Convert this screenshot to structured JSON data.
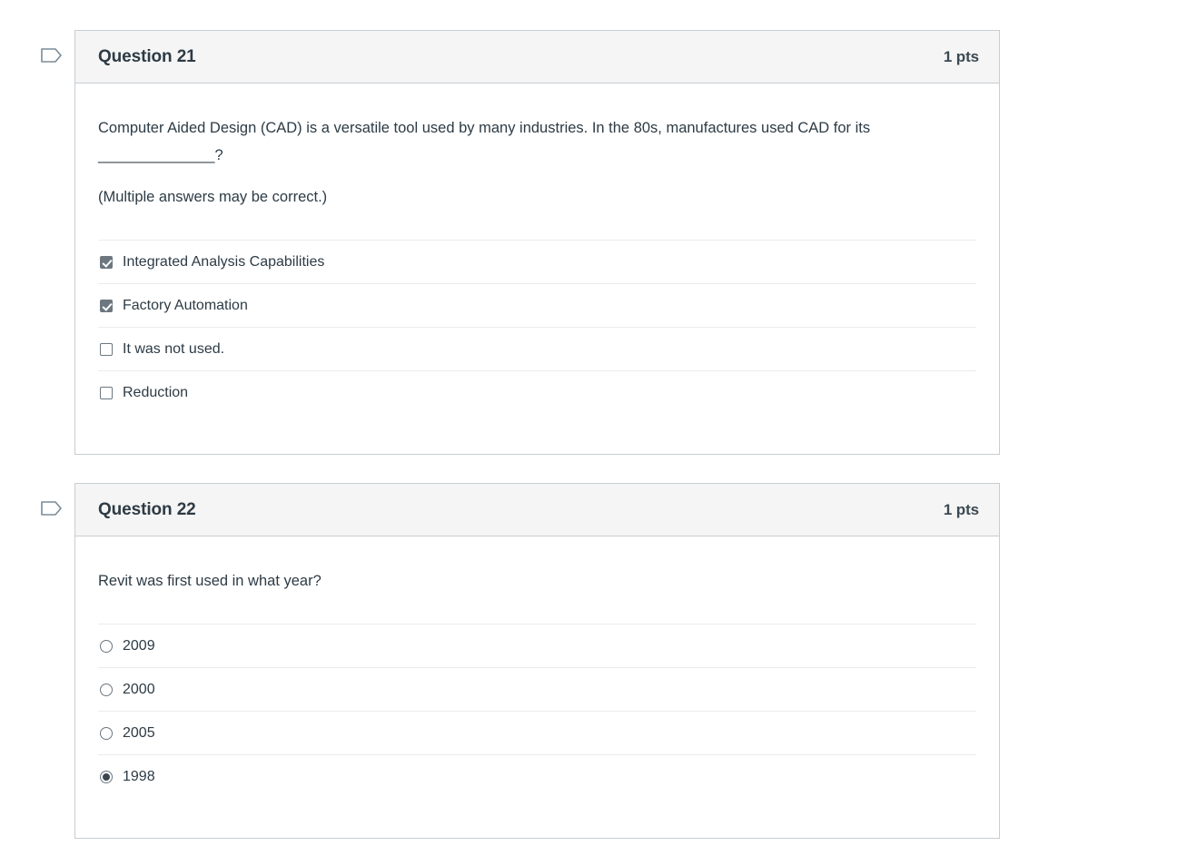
{
  "questions": [
    {
      "id": "q21",
      "name": "Question 21",
      "points": "1 pts",
      "flag_icon": "flag-outline-icon",
      "type": "multiple_answers",
      "prompt_lines": [
        "Computer Aided Design (CAD) is a versatile tool used by many industries. In the 80s, manufactures used CAD for its ______________?",
        "(Multiple answers may be correct.)"
      ],
      "answers": [
        {
          "label": "Integrated Analysis Capabilities",
          "checked": true
        },
        {
          "label": "Factory Automation",
          "checked": true
        },
        {
          "label": "It was not used.",
          "checked": false
        },
        {
          "label": "Reduction",
          "checked": false
        }
      ]
    },
    {
      "id": "q22",
      "name": "Question 22",
      "points": "1 pts",
      "flag_icon": "flag-outline-icon",
      "type": "multiple_choice",
      "prompt_lines": [
        "Revit was first used in what year?"
      ],
      "answers": [
        {
          "label": "2009",
          "checked": false
        },
        {
          "label": "2000",
          "checked": false
        },
        {
          "label": "2005",
          "checked": false
        },
        {
          "label": "1998",
          "checked": true
        }
      ]
    }
  ],
  "colors": {
    "card_border": "#c7cdd1",
    "header_background": "#f5f5f5",
    "text": "#2d3b45",
    "separator": "#eaeced",
    "flag_stroke": "#7a8b99",
    "control_selected": "#6c7780"
  }
}
